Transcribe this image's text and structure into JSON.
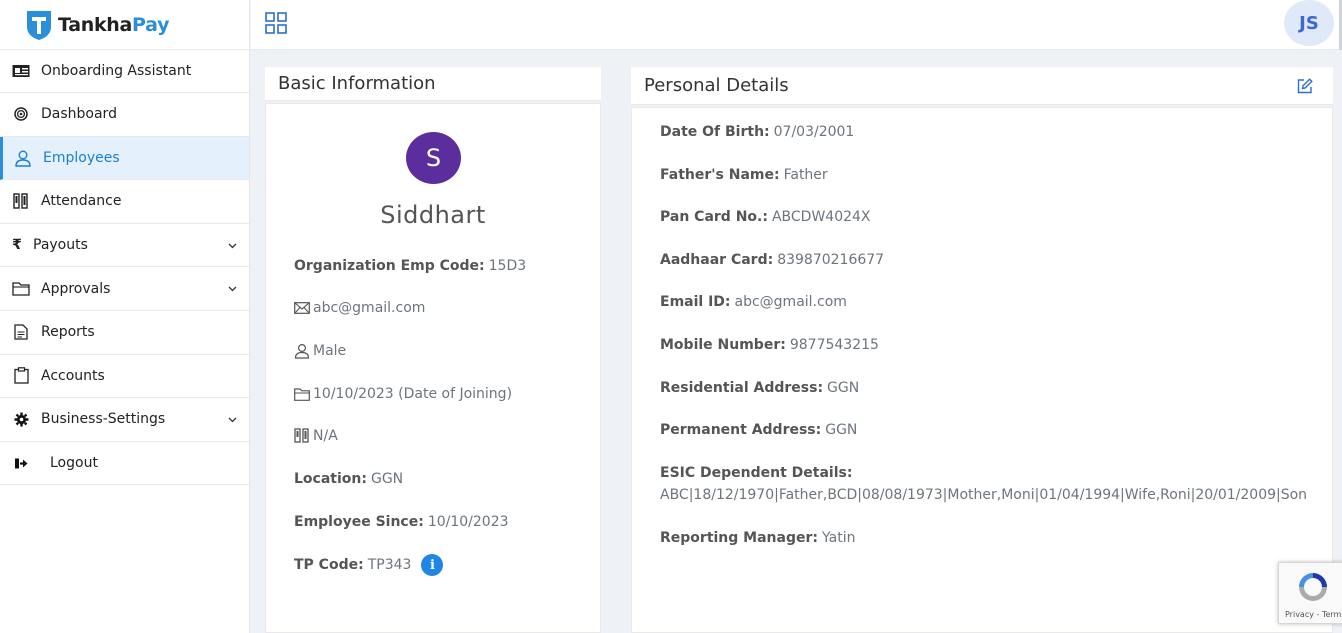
{
  "brand": {
    "part1": "Tankha",
    "part2": "Pay"
  },
  "user_initials": "JS",
  "sidebar": {
    "items": [
      {
        "label": "Onboarding Assistant",
        "icon": "id-card-icon",
        "active": false,
        "has_chevron": false
      },
      {
        "label": "Dashboard",
        "icon": "target-icon",
        "active": false,
        "has_chevron": false
      },
      {
        "label": "Employees",
        "icon": "user-icon",
        "active": true,
        "has_chevron": false
      },
      {
        "label": "Attendance",
        "icon": "attendance-icon",
        "active": false,
        "has_chevron": false
      },
      {
        "label": "Payouts",
        "icon": "rupee-icon",
        "active": false,
        "has_chevron": true
      },
      {
        "label": "Approvals",
        "icon": "folder-icon",
        "active": false,
        "has_chevron": true
      },
      {
        "label": "Reports",
        "icon": "report-icon",
        "active": false,
        "has_chevron": false
      },
      {
        "label": "Accounts",
        "icon": "clipboard-icon",
        "active": false,
        "has_chevron": false
      },
      {
        "label": "Business-Settings",
        "icon": "gear-icon",
        "active": false,
        "has_chevron": true
      },
      {
        "label": "Logout",
        "icon": "logout-icon",
        "active": false,
        "has_chevron": false
      }
    ]
  },
  "basic_info": {
    "title": "Basic Information",
    "avatar_letter": "S",
    "name": "Siddhart",
    "org_code_label": "Organization Emp Code:",
    "org_code_value": "15D3",
    "email": "abc@gmail.com",
    "gender": "Male",
    "joining": "10/10/2023 (Date of Joining)",
    "attendance": "N/A",
    "location_label": "Location:",
    "location_value": "GGN",
    "since_label": "Employee Since:",
    "since_value": "10/10/2023",
    "tp_label": "TP Code:",
    "tp_value": "TP343",
    "info_glyph": "i"
  },
  "personal": {
    "title": "Personal Details",
    "dob_label": "Date Of Birth:",
    "dob_value": "07/03/2001",
    "father_label": "Father's Name:",
    "father_value": "Father",
    "pan_label": "Pan Card No.:",
    "pan_value": "ABCDW4024X",
    "aadhaar_label": "Aadhaar Card:",
    "aadhaar_value": "839870216677",
    "email_label": "Email ID:",
    "email_value": "abc@gmail.com",
    "mobile_label": "Mobile Number:",
    "mobile_value": "9877543215",
    "res_label": "Residential Address:",
    "res_value": "GGN",
    "perm_label": "Permanent Address:",
    "perm_value": "GGN",
    "esic_label": "ESIC Dependent Details:",
    "esic_value": "ABC|18/12/1970|Father,BCD|08/08/1973|Mother,Moni|01/04/1994|Wife,Roni|20/01/2009|Son",
    "manager_label": "Reporting Manager:",
    "manager_value": "Yatin"
  },
  "recaptcha": {
    "text": "Privacy - Terms"
  },
  "colors": {
    "accent": "#2a8fd8",
    "active_bg": "#e4f1fd",
    "avatar": "#5c2d9c",
    "info": "#1f86e6"
  }
}
